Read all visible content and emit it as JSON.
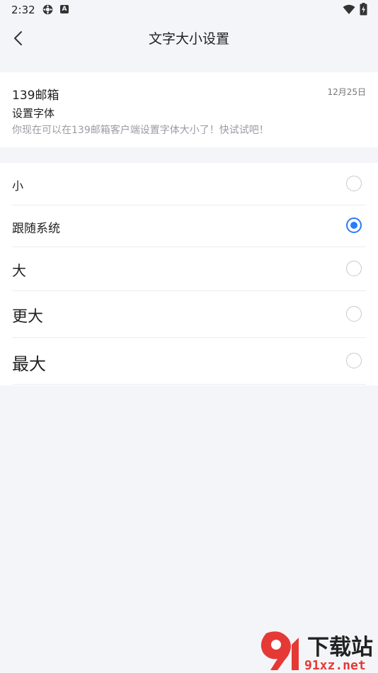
{
  "status_bar": {
    "time": "2:32",
    "icons": [
      "gear-icon",
      "a-notification-icon",
      "wifi-icon",
      "battery-icon"
    ]
  },
  "nav": {
    "title": "文字大小设置",
    "back_icon": "chevron-left-icon"
  },
  "preview": {
    "sender": "139邮箱",
    "date": "12月25日",
    "subject": "设置字体",
    "body": "你现在可以在139邮箱客户端设置字体大小了！快试试吧！"
  },
  "options": {
    "items": [
      {
        "label": "小",
        "checked": false
      },
      {
        "label": "跟随系统",
        "checked": true
      },
      {
        "label": "大",
        "checked": false
      },
      {
        "label": "更大",
        "checked": false
      },
      {
        "label": "最大",
        "checked": false
      }
    ]
  },
  "watermark": {
    "brand": "下载站",
    "domain": "91xz.net"
  },
  "colors": {
    "accent": "#2a7cf7",
    "background": "#f4f5f9",
    "watermark_red": "#e53935"
  }
}
